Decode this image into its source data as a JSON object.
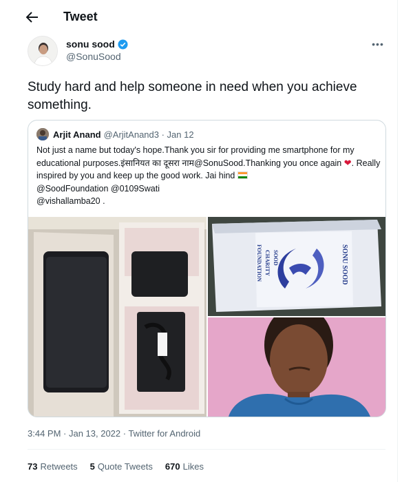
{
  "header": {
    "title": "Tweet",
    "back_icon": "arrow-left-icon"
  },
  "author": {
    "name": "sonu sood",
    "handle": "@SonuSood",
    "verified_color": "#1d9bf0",
    "more_label": "•••"
  },
  "tweet": {
    "text": "Study hard and help someone in need when you achieve something."
  },
  "quote": {
    "name": "Arjit Anand",
    "handle": "@ArjitAnand3 · Jan 12",
    "text_part1": "Not just a name but today's hope.Thank you sir for providing me smartphone for my educational purposes.इंसानियत का दूसरा नाम@SonuSood.Thanking you once again ",
    "text_part2": ". Really inspired by you and keep up the good work. Jai hind",
    "text_part3": "@SoodFoundation @0109Swati",
    "text_part4": "@vishallamba20 .",
    "box_lines": [
      "SONU SOOD",
      "SOOD",
      "CHARITY",
      "FOUNDATION"
    ]
  },
  "meta": {
    "timestamp": "3:44 PM · Jan 13, 2022 · Twitter for Android"
  },
  "stats": {
    "retweets_count": "73",
    "retweets_label": "Retweets",
    "quotes_count": "5",
    "quotes_label": "Quote Tweets",
    "likes_count": "670",
    "likes_label": "Likes"
  },
  "colors": {
    "text_primary": "#0f1419",
    "text_secondary": "#536471",
    "border": "#cfd9de",
    "accent": "#1d9bf0"
  }
}
